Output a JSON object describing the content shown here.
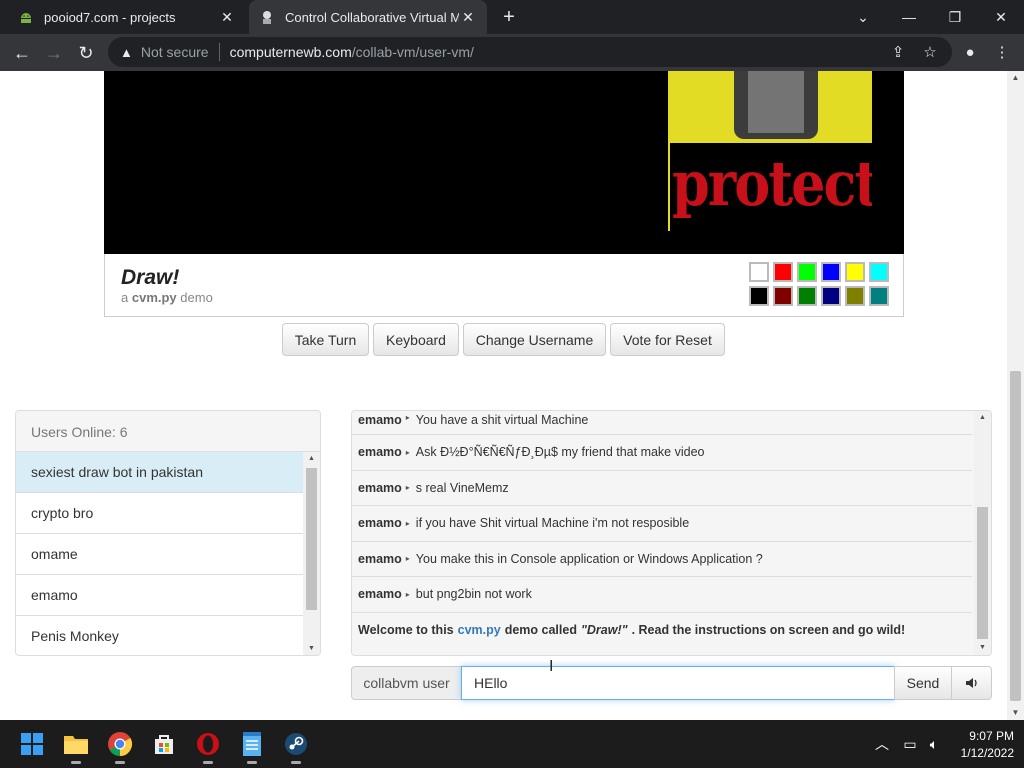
{
  "browser": {
    "tabs": [
      {
        "title": "pooiod7.com - projects",
        "icon": "android-icon"
      },
      {
        "title": "Control Collaborative Virtual Machine",
        "icon": "vm-icon"
      }
    ],
    "new_tab": "+",
    "url_warning": "Not secure",
    "url_host": "computernewb.com",
    "url_path": "/collab-vm/user-vm/"
  },
  "draw": {
    "title": "Draw!",
    "sub_prefix": "a",
    "sub_brand": "cvm.py",
    "sub_suffix": "demo",
    "palette": [
      "#ffffff",
      "#ff0000",
      "#00ff00",
      "#0000ff",
      "#ffff00",
      "#00ffff",
      "#000000",
      "#800000",
      "#008000",
      "#000080",
      "#808000",
      "#008080"
    ]
  },
  "vm_screen": {
    "art_text": "protection"
  },
  "controls": {
    "take_turn": "Take Turn",
    "keyboard": "Keyboard",
    "change_username": "Change Username",
    "vote_reset": "Vote for Reset"
  },
  "users": {
    "header": "Users Online: 6",
    "list": [
      "sexiest draw bot in pakistan",
      "crypto bro",
      "omame",
      "emamo",
      "Penis Monkey"
    ]
  },
  "chat": {
    "messages": [
      {
        "user": "emamo",
        "text": "You have a shit virtual Machine"
      },
      {
        "user": "emamo",
        "text": "Ask Đ½Đ°Ñ€Ñ€ÑƒĐ¸Đµ$ my friend that make video"
      },
      {
        "user": "emamo",
        "text": "s real VineMemz"
      },
      {
        "user": "emamo",
        "text": "if you have Shit virtual Machine i'm not resposible"
      },
      {
        "user": "emamo",
        "text": "You make this in Console application or Windows Application ?"
      },
      {
        "user": "emamo",
        "text": "but png2bin not work"
      }
    ],
    "welcome": {
      "pre": "Welcome to this",
      "link": "cvm.py",
      "mid": "demo called",
      "name": "\"Draw!\"",
      "post": ". Read the instructions on screen and go wild!"
    },
    "username": "collabvm user",
    "input_value": "HEllo",
    "send": "Send"
  },
  "taskbar": {
    "time": "9:07 PM",
    "date": "1/12/2022"
  }
}
